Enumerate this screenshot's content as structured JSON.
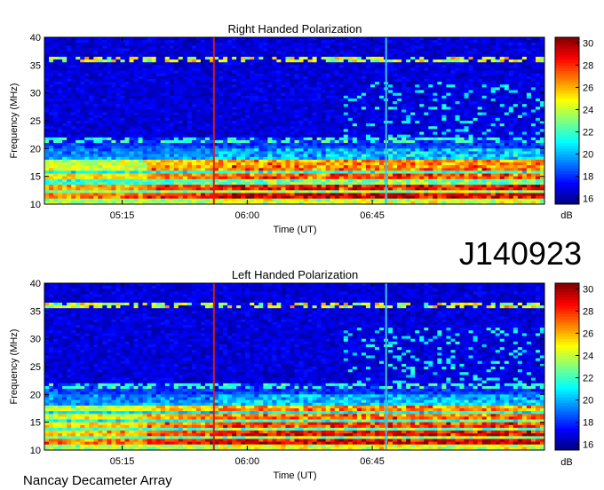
{
  "event_id": "J140923",
  "footer": "Nancay Decameter Array",
  "colorbar": {
    "unit": "dB",
    "ticks": [
      "16",
      "18",
      "20",
      "22",
      "24",
      "26",
      "28",
      "30"
    ],
    "range": [
      15.5,
      30.5
    ]
  },
  "chart_data": [
    {
      "type": "heatmap",
      "title": "Right Handed Polarization",
      "xlabel": "Time (UT)",
      "ylabel": "Frequency (MHz)",
      "x_ticks": [
        "05:15",
        "06:00",
        "06:45"
      ],
      "y_ticks": [
        "10",
        "15",
        "20",
        "25",
        "30",
        "35",
        "40"
      ],
      "xlim": [
        "04:47",
        "07:47"
      ],
      "ylim": [
        10,
        40
      ],
      "value_unit": "dB",
      "value_range": [
        16,
        30
      ],
      "vertical_lines_time": [
        "05:48",
        "06:50"
      ],
      "hot_bands_mhz": [
        11.5,
        13,
        15,
        16.5,
        17.5
      ],
      "band_start_time": "05:48",
      "grid": false
    },
    {
      "type": "heatmap",
      "title": "Left Handed Polarization",
      "xlabel": "Time (UT)",
      "ylabel": "Frequency (MHz)",
      "x_ticks": [
        "05:15",
        "06:00",
        "06:45"
      ],
      "y_ticks": [
        "10",
        "15",
        "20",
        "25",
        "30",
        "35",
        "40"
      ],
      "xlim": [
        "04:47",
        "07:47"
      ],
      "ylim": [
        10,
        40
      ],
      "value_unit": "dB",
      "value_range": [
        16,
        30
      ],
      "vertical_lines_time": [
        "05:48",
        "06:50"
      ],
      "hot_bands_mhz": [
        11.5,
        13,
        14.5,
        16,
        17.5
      ],
      "band_start_time": "05:48",
      "grid": false
    }
  ]
}
